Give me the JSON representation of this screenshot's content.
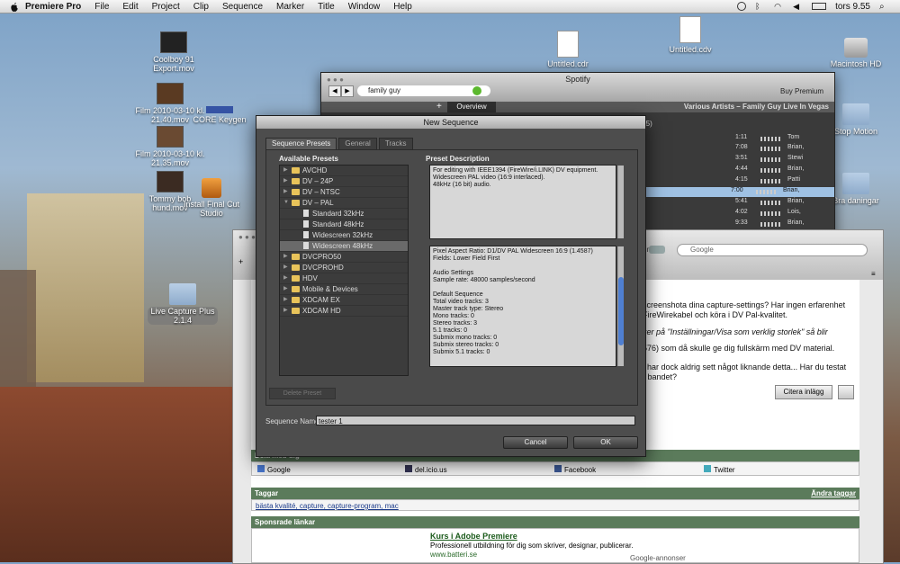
{
  "menubar": {
    "app": "Premiere Pro",
    "items": [
      "File",
      "Edit",
      "Project",
      "Clip",
      "Sequence",
      "Marker",
      "Title",
      "Window",
      "Help"
    ],
    "clock": "tors 9.55"
  },
  "desktop": {
    "icons": {
      "coolboy": "Coolboy 91\nExport.mov",
      "film1": "Film 2010-03-10 kl.\n21.40.mov",
      "core": "CORE Keygen",
      "film2": "Film 2010-03-10 kl.\n21.35.mov",
      "tommy": "Tommy bob\nhund.mov",
      "installfcs": "Install Final Cut\nStudio",
      "livecapture": "Live Capture Plus\n2.1.4",
      "untitledcdr": "Untitled.cdr",
      "untitledcdv": "Untitled.cdv",
      "macintosh": "Macintosh HD",
      "stopmotion": "Stop Motion",
      "bradaningar": "Bra daningar"
    }
  },
  "spotify": {
    "title": "Spotify",
    "search_value": "family guy",
    "buy_premium": "Buy Premium",
    "tab_overview": "Overview",
    "artist_header": "Various Artists – Family Guy Live In Vegas",
    "row_count_label": "(5)",
    "rows": [
      {
        "time": "1:11",
        "artist": "Tom"
      },
      {
        "time": "7:08",
        "artist": "Brian,"
      },
      {
        "time": "3:51",
        "artist": "Stewi"
      },
      {
        "time": "4:44",
        "artist": "Brian,"
      },
      {
        "time": "4:15",
        "artist": "Patti"
      },
      {
        "time": "7:00",
        "artist": "Brian,"
      },
      {
        "time": "5:41",
        "artist": "Brian,"
      },
      {
        "time": "4:02",
        "artist": "Lois,"
      },
      {
        "time": "9:33",
        "artist": "Brian,"
      }
    ]
  },
  "browser": {
    "url_suffix": "orum",
    "search_placeholder": "Google",
    "text": {
      "line1": "screenshota dina capture-settings? Har ingen erfarenhet",
      "line2": "FireWirekabel och köra i DV Pal-kvalitet.",
      "line3": "ker på \"Inställningar/Visa som verklig storlek\" så blir",
      "line4": "576) som då skulle ge dig fullskärm med DV material.",
      "line5": ", har dock aldrig sett något liknande detta... Har du testat",
      "line6": "r bandet?"
    },
    "cite_button": "Citera inlägg",
    "share_header": "Dela med dig",
    "share": [
      "Google",
      "del.icio.us",
      "Facebook",
      "Twitter"
    ],
    "tags_header": "Taggar",
    "tags_edit": "Ändra taggar",
    "tags": "bästa kvalité, capture, capture-program, mac",
    "sponsored_header": "Sponsrade länkar",
    "ad_title": "Kurs i Adobe Premiere",
    "ad_text": "Professionell utbildning för dig som skriver, designar, publicerar.",
    "ad_url": "www.batteri.se",
    "ad_google": "Google-annonser"
  },
  "dialog": {
    "title": "New Sequence",
    "tabs": [
      "Sequence Presets",
      "General",
      "Tracks"
    ],
    "available_presets_label": "Available Presets",
    "preset_description_label": "Preset Description",
    "tree": [
      {
        "label": "AVCHD",
        "type": "folder",
        "expanded": false,
        "level": 0
      },
      {
        "label": "DV – 24P",
        "type": "folder",
        "expanded": false,
        "level": 0
      },
      {
        "label": "DV – NTSC",
        "type": "folder",
        "expanded": false,
        "level": 0
      },
      {
        "label": "DV – PAL",
        "type": "folder",
        "expanded": true,
        "level": 0
      },
      {
        "label": "Standard 32kHz",
        "type": "file",
        "level": 1
      },
      {
        "label": "Standard 48kHz",
        "type": "file",
        "level": 1
      },
      {
        "label": "Widescreen 32kHz",
        "type": "file",
        "level": 1
      },
      {
        "label": "Widescreen 48kHz",
        "type": "file",
        "level": 1,
        "selected": true
      },
      {
        "label": "DVCPRO50",
        "type": "folder",
        "expanded": false,
        "level": 0
      },
      {
        "label": "DVCPROHD",
        "type": "folder",
        "expanded": false,
        "level": 0
      },
      {
        "label": "HDV",
        "type": "folder",
        "expanded": false,
        "level": 0
      },
      {
        "label": "Mobile & Devices",
        "type": "folder",
        "expanded": false,
        "level": 0
      },
      {
        "label": "XDCAM EX",
        "type": "folder",
        "expanded": false,
        "level": 0
      },
      {
        "label": "XDCAM HD",
        "type": "folder",
        "expanded": false,
        "level": 0
      }
    ],
    "description": "For editing with IEEE1394 (FireWire/i.LINK) DV equipment.\nWidescreen PAL video (16:9 interlaced).\n48kHz (16 bit) audio.",
    "details": "Pixel Aspect Ratio: D1/DV PAL Widescreen 16:9 (1.4587)\nFields: Lower Field First\n\nAudio Settings\nSample rate: 48000 samples/second\n\nDefault Sequence\nTotal video tracks: 3\nMaster track type: Stereo\nMono tracks: 0\nStereo tracks: 3\n5.1 tracks: 0\nSubmix mono tracks: 0\nSubmix stereo tracks: 0\nSubmix 5.1 tracks: 0",
    "delete_preset": "Delete Preset",
    "sequence_name_label": "Sequence Name:",
    "sequence_name_value": "tester 1",
    "cancel": "Cancel",
    "ok": "OK"
  }
}
